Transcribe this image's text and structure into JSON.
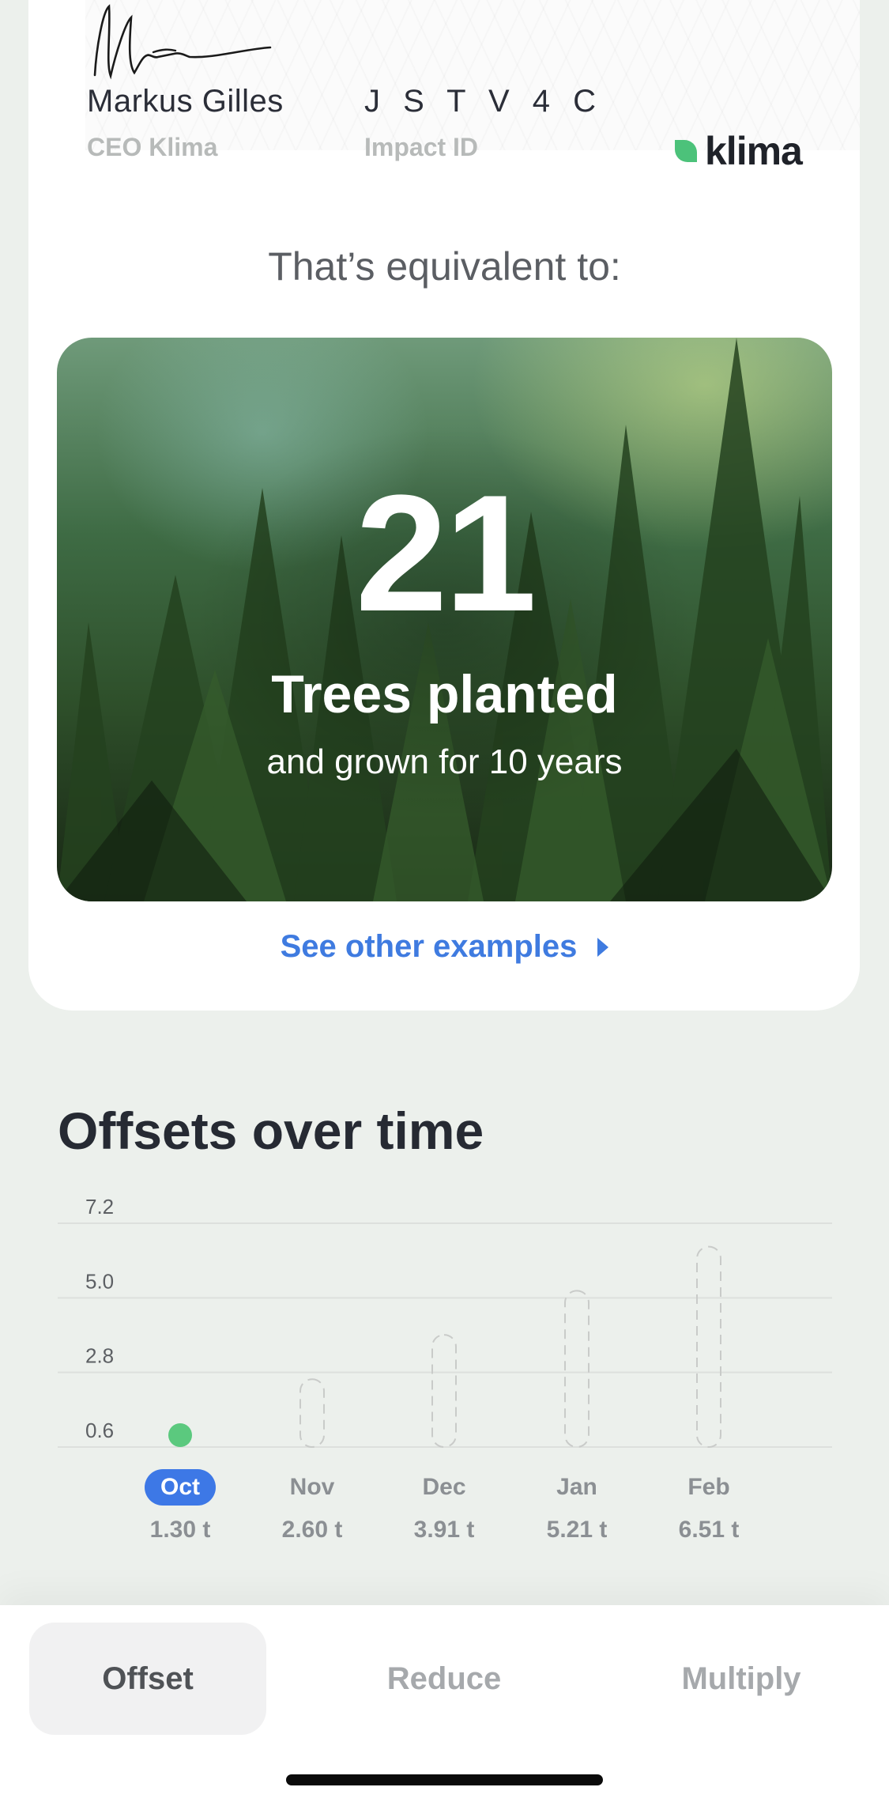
{
  "certificate": {
    "signer_name": "Markus Gilles",
    "signer_role": "CEO Klima",
    "impact_id_value": "J S T V 4 C",
    "impact_id_label": "Impact ID",
    "brand": "klima"
  },
  "equivalent": {
    "title": "That’s equivalent to:",
    "count": "21",
    "headline": "Trees planted",
    "subline": "and grown for 10 years",
    "link": "See other examples"
  },
  "offsets": {
    "title": "Offsets over time",
    "chart_data": {
      "type": "bar",
      "categories": [
        "Oct",
        "Nov",
        "Dec",
        "Jan",
        "Feb"
      ],
      "values": [
        1.3,
        2.6,
        3.91,
        5.21,
        6.51
      ],
      "value_labels": [
        "1.30 t",
        "2.60 t",
        "3.91 t",
        "5.21 t",
        "6.51 t"
      ],
      "y_ticks": [
        "7.2",
        "5.0",
        "2.8",
        "0.6"
      ],
      "ylim": [
        0.6,
        7.2
      ],
      "current_index": 0,
      "grid": true,
      "colors": {
        "current": "#5bc97e",
        "future_outline": "#c9cbc9",
        "active_pill": "#3d78e6"
      }
    }
  },
  "tabs": [
    {
      "label": "Offset",
      "active": true
    },
    {
      "label": "Reduce",
      "active": false
    },
    {
      "label": "Multiply",
      "active": false
    }
  ]
}
